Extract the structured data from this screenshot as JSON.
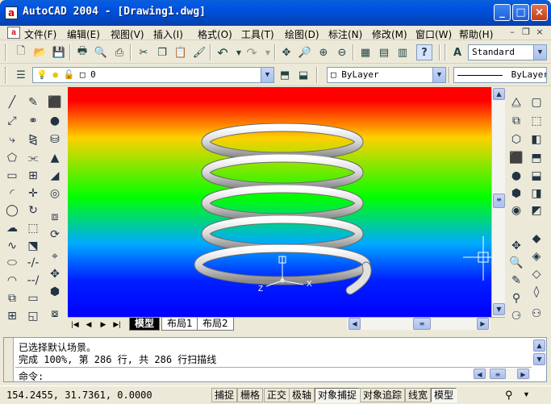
{
  "window": {
    "title": "AutoCAD 2004 - [Drawing1.dwg]",
    "min_glyph": "_",
    "max_glyph": "□",
    "close_glyph": "×"
  },
  "menu": {
    "items": [
      "文件(F)",
      "编辑(E)",
      "视图(V)",
      "插入(I)",
      "格式(O)",
      "工具(T)",
      "绘图(D)",
      "标注(N)",
      "修改(M)",
      "窗口(W)",
      "帮助(H)"
    ],
    "doc_min": "–",
    "doc_restore": "❐",
    "doc_close": "×"
  },
  "toolbar": {
    "text_style": "Standard",
    "layer_value": "0",
    "color_value": "ByLayer",
    "linetype_value": "ByLayer"
  },
  "icons": [
    "new-icon",
    "open-icon",
    "save-icon",
    "print-icon",
    "preview-icon",
    "publish-icon",
    "cut-icon",
    "copy-icon",
    "paste-icon",
    "match-properties-icon",
    "undo-icon",
    "redo-icon",
    "pan-icon",
    "zoom-realtime-icon",
    "zoom-window-icon",
    "zoom-previous-icon",
    "properties-icon",
    "design-center-icon",
    "tool-palettes-icon",
    "help-icon",
    "text-style-icon"
  ],
  "viewport": {
    "ucs_x": "X",
    "ucs_z": "Z"
  },
  "tabs": {
    "model": "模型",
    "layout1": "布局1",
    "layout2": "布局2"
  },
  "command": {
    "line1": "已选择默认场景。",
    "line2": "完成 100%, 第 286 行, 共 286 行扫描线",
    "prompt": "命令:"
  },
  "status": {
    "coords": "154.2455,  31.7361, 0.0000",
    "toggles": [
      "捕捉",
      "栅格",
      "正交",
      "极轴",
      "对象捕捉",
      "对象追踪",
      "线宽",
      "模型"
    ]
  },
  "colors": {
    "title_bar": "#0054e3",
    "viewport_top": "#ff0000",
    "viewport_mid": "#00ff00",
    "viewport_bottom": "#0000ff"
  }
}
